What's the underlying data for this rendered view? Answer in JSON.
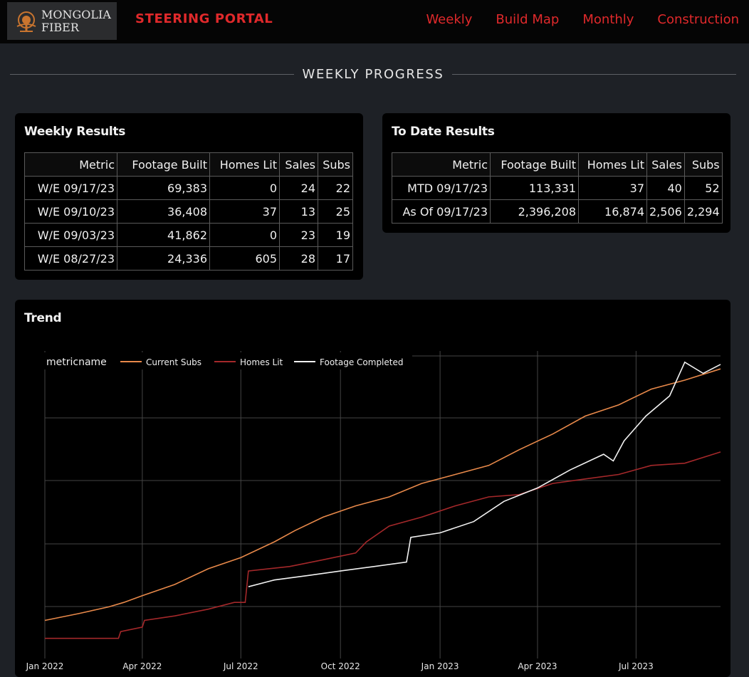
{
  "header": {
    "logo_line1": "MONGOLIA",
    "logo_line2": "FIBER",
    "portal_title": "STEERING PORTAL",
    "nav": [
      "Weekly",
      "Build Map",
      "Monthly",
      "Construction"
    ]
  },
  "section_title": "WEEKLY PROGRESS",
  "weekly": {
    "title": "Weekly Results",
    "columns": [
      "Metric",
      "Footage Built",
      "Homes Lit",
      "Sales",
      "Subs"
    ],
    "rows": [
      [
        "W/E 09/17/23",
        "69,383",
        "0",
        "24",
        "22"
      ],
      [
        "W/E 09/10/23",
        "36,408",
        "37",
        "13",
        "25"
      ],
      [
        "W/E 09/03/23",
        "41,862",
        "0",
        "23",
        "19"
      ],
      [
        "W/E 08/27/23",
        "24,336",
        "605",
        "28",
        "17"
      ]
    ]
  },
  "todate": {
    "title": "To Date Results",
    "columns": [
      "Metric",
      "Footage Built",
      "Homes Lit",
      "Sales",
      "Subs"
    ],
    "rows": [
      [
        "MTD 09/17/23",
        "113,331",
        "37",
        "40",
        "52"
      ],
      [
        "As Of 09/17/23",
        "2,396,208",
        "16,874",
        "2,506",
        "2,294"
      ]
    ]
  },
  "trend": {
    "title": "Trend",
    "colors": {
      "current_subs": "#e8894a",
      "homes_lit": "#a4282a",
      "footage_completed": "#f2f2f2",
      "grid": "#444444"
    },
    "chart_data": {
      "type": "line",
      "legend_title": "metricname",
      "legend_placement": "top-left",
      "grid": true,
      "x_ticks": [
        "Jan 2022",
        "Apr 2022",
        "Jul 2022",
        "Oct 2022",
        "Jan 2023",
        "Apr 2023",
        "Jul 2023"
      ],
      "x_range": [
        "2022-01-01",
        "2023-09-17"
      ],
      "y_range": [
        0,
        1
      ],
      "series": [
        {
          "name": "Current Subs",
          "points": [
            [
              "2022-01-01",
              0.2
            ],
            [
              "2022-02-01",
              0.23
            ],
            [
              "2022-03-01",
              0.26
            ],
            [
              "2022-03-15",
              0.28
            ],
            [
              "2022-04-01",
              0.31
            ],
            [
              "2022-05-01",
              0.36
            ],
            [
              "2022-06-01",
              0.43
            ],
            [
              "2022-07-01",
              0.48
            ],
            [
              "2022-08-01",
              0.55
            ],
            [
              "2022-08-20",
              0.6
            ],
            [
              "2022-09-15",
              0.66
            ],
            [
              "2022-10-15",
              0.71
            ],
            [
              "2022-11-15",
              0.75
            ],
            [
              "2022-12-15",
              0.81
            ],
            [
              "2023-01-15",
              0.85
            ],
            [
              "2023-02-15",
              0.89
            ],
            [
              "2023-03-15",
              0.96
            ],
            [
              "2023-04-15",
              1.03
            ],
            [
              "2023-05-15",
              1.11
            ],
            [
              "2023-06-15",
              1.16
            ],
            [
              "2023-07-15",
              1.23
            ],
            [
              "2023-08-15",
              1.27
            ],
            [
              "2023-09-17",
              1.32
            ]
          ]
        },
        {
          "name": "Homes Lit",
          "points": [
            [
              "2022-01-01",
              0.12
            ],
            [
              "2022-03-10",
              0.12
            ],
            [
              "2022-03-12",
              0.15
            ],
            [
              "2022-04-01",
              0.17
            ],
            [
              "2022-04-03",
              0.2
            ],
            [
              "2022-05-01",
              0.22
            ],
            [
              "2022-06-01",
              0.25
            ],
            [
              "2022-06-25",
              0.28
            ],
            [
              "2022-07-05",
              0.28
            ],
            [
              "2022-07-08",
              0.42
            ],
            [
              "2022-08-15",
              0.44
            ],
            [
              "2022-09-15",
              0.47
            ],
            [
              "2022-10-15",
              0.5
            ],
            [
              "2022-10-25",
              0.55
            ],
            [
              "2022-11-15",
              0.62
            ],
            [
              "2022-12-15",
              0.66
            ],
            [
              "2023-01-15",
              0.71
            ],
            [
              "2023-02-15",
              0.75
            ],
            [
              "2023-03-15",
              0.76
            ],
            [
              "2023-04-15",
              0.81
            ],
            [
              "2023-05-15",
              0.83
            ],
            [
              "2023-06-15",
              0.85
            ],
            [
              "2023-07-15",
              0.89
            ],
            [
              "2023-08-15",
              0.9
            ],
            [
              "2023-09-17",
              0.95
            ]
          ]
        },
        {
          "name": "Footage Completed",
          "points": [
            [
              "2022-07-08",
              0.35
            ],
            [
              "2022-08-01",
              0.38
            ],
            [
              "2022-09-01",
              0.4
            ],
            [
              "2022-10-01",
              0.42
            ],
            [
              "2022-11-01",
              0.44
            ],
            [
              "2022-12-01",
              0.46
            ],
            [
              "2022-12-05",
              0.57
            ],
            [
              "2023-01-01",
              0.59
            ],
            [
              "2023-02-01",
              0.64
            ],
            [
              "2023-03-01",
              0.73
            ],
            [
              "2023-04-01",
              0.79
            ],
            [
              "2023-05-01",
              0.87
            ],
            [
              "2023-06-01",
              0.94
            ],
            [
              "2023-06-10",
              0.91
            ],
            [
              "2023-06-20",
              1.0
            ],
            [
              "2023-07-10",
              1.11
            ],
            [
              "2023-08-01",
              1.2
            ],
            [
              "2023-08-15",
              1.35
            ],
            [
              "2023-09-01",
              1.3
            ],
            [
              "2023-09-17",
              1.34
            ]
          ]
        }
      ]
    }
  }
}
